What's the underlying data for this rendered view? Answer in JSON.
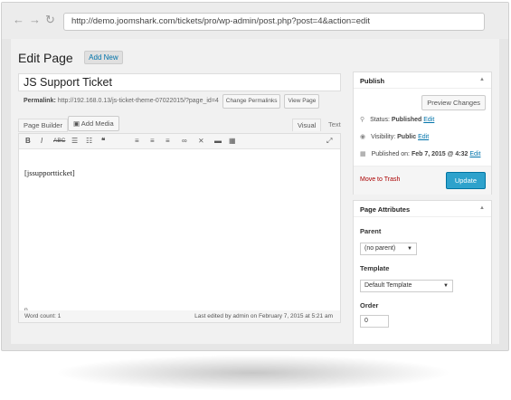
{
  "browser": {
    "url": "http://demo.joomshark.com/tickets/pro/wp-admin/post.php?post=4&action=edit",
    "back_glyph": "←",
    "forward_glyph": "→",
    "reload_glyph": "↻"
  },
  "header": {
    "title": "Edit Page",
    "add_new_label": "Add New"
  },
  "post": {
    "title": "JS Support Ticket",
    "permalink_label": "Permalink:",
    "permalink_url": "http://192.168.0.13/js-ticket-theme-07022015/?page_id=4",
    "change_permalinks_label": "Change Permalinks",
    "view_page_label": "View Page"
  },
  "editor": {
    "page_builder_label": "Page Builder",
    "add_media_label": "Add Media",
    "tab_visual": "Visual",
    "tab_text": "Text",
    "content": "[jssupportticket]",
    "path": "p",
    "word_count": "Word count: 1",
    "last_edited": "Last edited by admin on February 7, 2015 at 5:21 am",
    "toolbar_icons": [
      "bold-icon",
      "italic-icon",
      "strikethrough-icon",
      "bullet-list-icon",
      "numbered-list-icon",
      "blockquote-icon",
      "align-left-icon",
      "align-center-icon",
      "align-right-icon",
      "link-icon",
      "unlink-icon",
      "read-more-icon",
      "toolbar-toggle-icon",
      "fullscreen-icon"
    ]
  },
  "publish": {
    "title": "Publish",
    "preview_label": "Preview Changes",
    "status_label": "Status:",
    "status_value": "Published",
    "visibility_label": "Visibility:",
    "visibility_value": "Public",
    "published_label": "Published on:",
    "published_value": "Feb 7, 2015 @ 4:32",
    "edit_label": "Edit",
    "trash_label": "Move to Trash",
    "update_label": "Update"
  },
  "attributes": {
    "title": "Page Attributes",
    "parent_label": "Parent",
    "parent_value": "(no parent)",
    "template_label": "Template",
    "template_value": "Default Template",
    "order_label": "Order",
    "order_value": "0"
  },
  "colors": {
    "accent": "#2ea2cc",
    "link": "#0073aa",
    "trash": "#aa0000"
  }
}
